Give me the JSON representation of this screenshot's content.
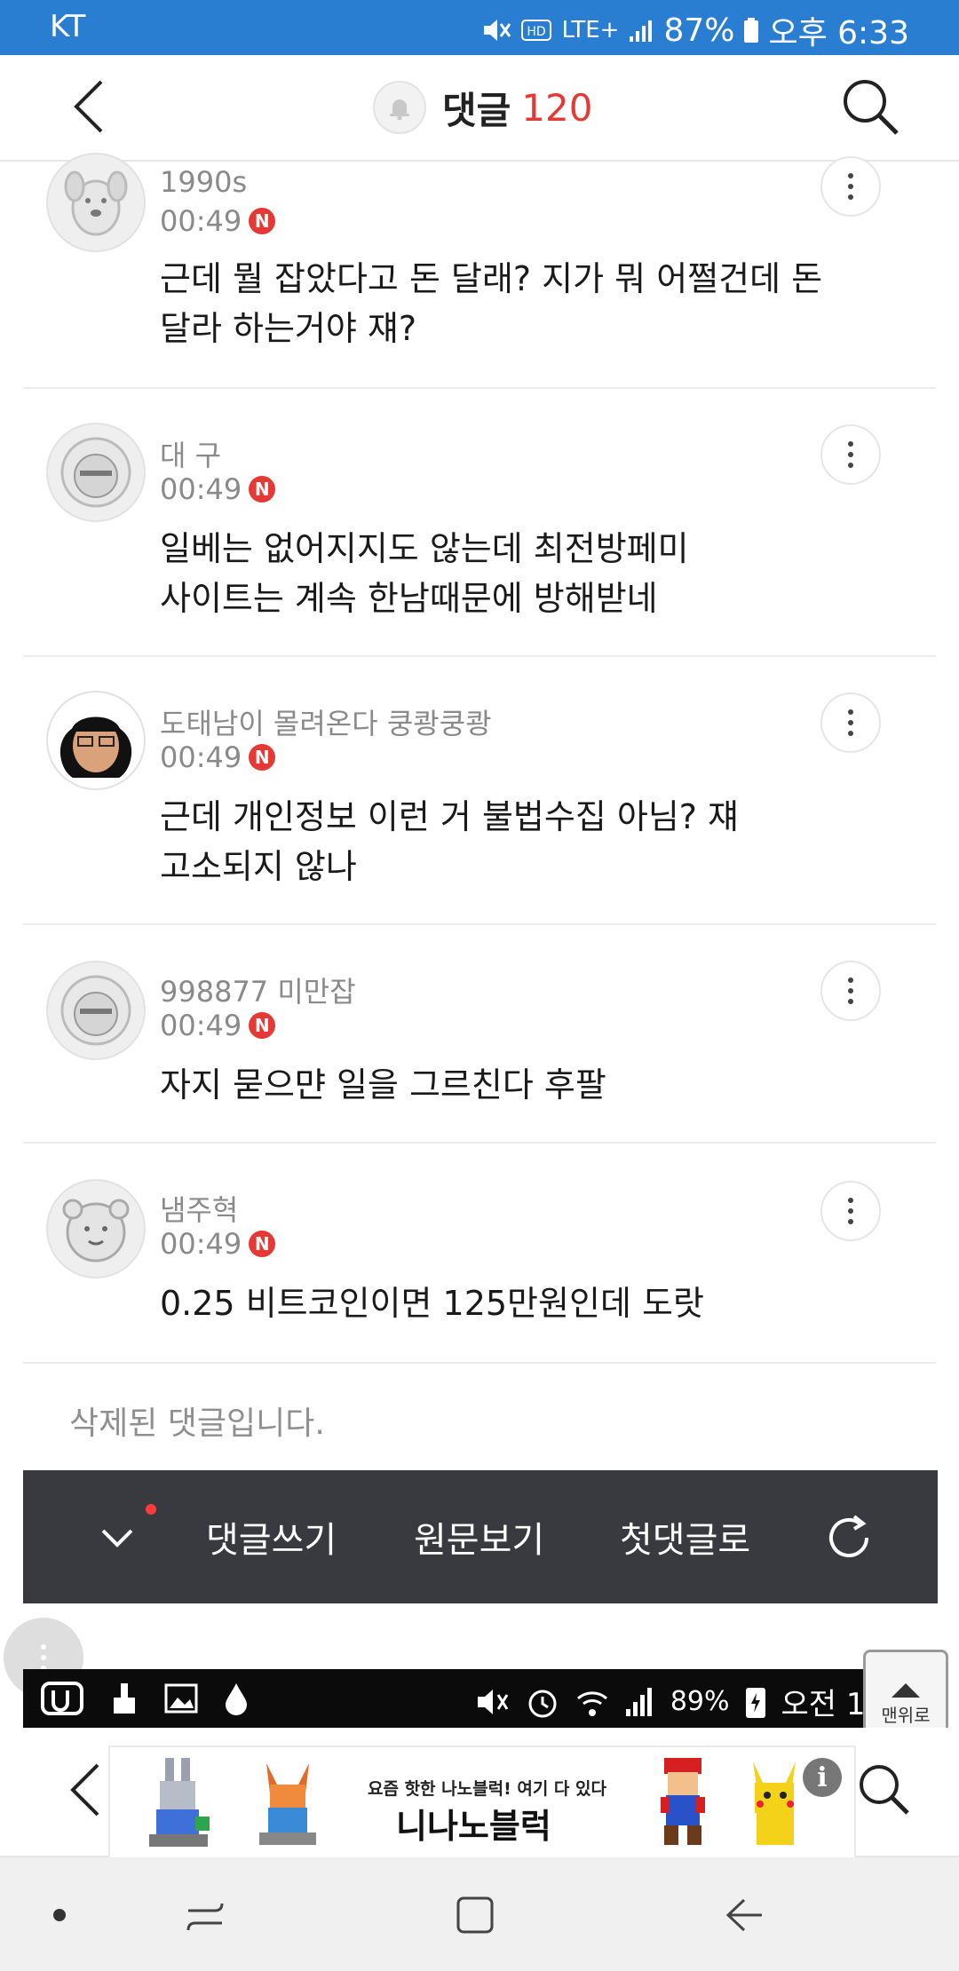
{
  "status_bar": {
    "carrier": "KT",
    "network": "LTE+",
    "battery": "87%",
    "time": "오후 6:33"
  },
  "header": {
    "title": "댓글",
    "count": "120"
  },
  "comments": [
    {
      "nickname": "1990s",
      "time": "00:49",
      "badge": "N",
      "text_lines": [
        "근데 뭘 잡았다고 돈 달래? 지가 뭐 어쩔건데 돈",
        "달라 하는거야 쟤?"
      ]
    },
    {
      "nickname": "대 구",
      "time": "00:49",
      "badge": "N",
      "text_lines": [
        "일베는 없어지지도 않는데 최전방페미",
        "사이트는 계속 한남때문에 방해받네"
      ]
    },
    {
      "nickname": "도태남이 몰려온다 쿵쾅쿵쾅",
      "time": "00:49",
      "badge": "N",
      "text_lines": [
        "근데 개인정보 이런 거 불법수집 아님? 쟤",
        "고소되지 않나"
      ]
    },
    {
      "nickname": "998877 미만잡",
      "time": "00:49",
      "badge": "N",
      "text_lines": [
        "자지 묻으먄 일을 그르친다 후팔"
      ]
    },
    {
      "nickname": "냄주혁",
      "time": "00:49",
      "badge": "N",
      "text_lines": [
        "0.25 비트코인이면 125만원인데 도랏"
      ]
    }
  ],
  "deleted_comment": "삭제된 댓글입니다.",
  "toolbar": {
    "write": "댓글쓰기",
    "view_original": "원문보기",
    "first_comment": "첫댓글로"
  },
  "to_top": {
    "label": "맨위로"
  },
  "inner_status_bar": {
    "battery": "89%",
    "time": "오전 1:"
  },
  "ad": {
    "tagline": "요즘 핫한 나노블럭! 여기 다 있다",
    "title": "니나노블럭"
  },
  "colors": {
    "status_bar": "#2a7ed2",
    "accent_red": "#e53935",
    "toolbar": "#393a3f"
  },
  "icons": [
    "back-arrow-icon",
    "bell-icon",
    "search-icon",
    "more-vertical-icon",
    "chevron-down-icon",
    "refresh-icon",
    "up-arrow-icon",
    "info-icon"
  ]
}
